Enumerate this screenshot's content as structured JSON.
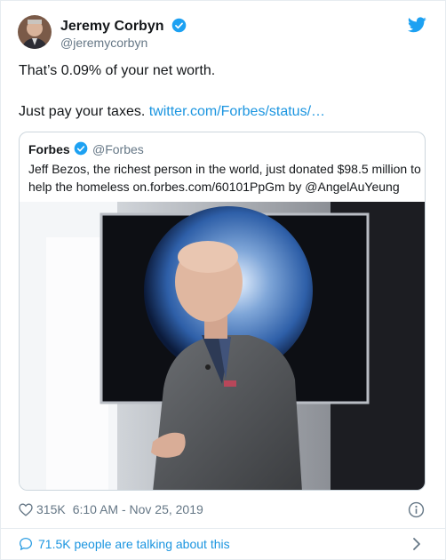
{
  "author": {
    "name": "Jeremy Corbyn",
    "handle": "@jeremycorbyn",
    "avatar_icon": "avatar-photo",
    "verified_icon": "verified-badge-icon"
  },
  "tweet": {
    "line1": "That’s 0.09% of your net worth.",
    "line2_text": "Just pay your taxes. ",
    "line2_link": "twitter.com/Forbes/status/…"
  },
  "quoted": {
    "name": "Forbes",
    "handle": "@Forbes",
    "text": "Jeff Bezos, the richest person in the world, just donated $98.5 million to help the homeless on.forbes.com/60101PpGm by @AngelAuYeung"
  },
  "footer": {
    "likes": "315K",
    "timestamp": "6:10 AM - Nov 25, 2019",
    "talking": "71.5K people are talking about this"
  },
  "colors": {
    "link": "#1b95e0",
    "muted": "#657786",
    "text": "#14171a",
    "twitter_blue": "#1da1f2"
  }
}
